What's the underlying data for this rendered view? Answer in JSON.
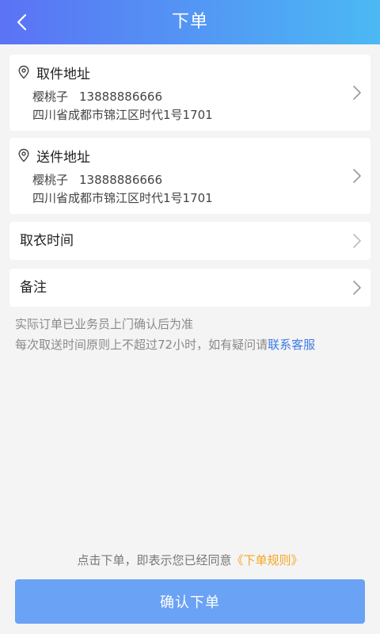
{
  "header": {
    "title": "下单"
  },
  "pickup": {
    "title": "取件地址",
    "name": "樱桃子",
    "phone": "13888886666",
    "address": "四川省成都市锦江区时代1号1701"
  },
  "delivery": {
    "title": "送件地址",
    "name": "樱桃子",
    "phone": "13888886666",
    "address": "四川省成都市锦江区时代1号1701"
  },
  "pickup_time": {
    "label": "取衣时间"
  },
  "remark": {
    "label": "备注"
  },
  "notes": {
    "line1": "实际订单已业务员上门确认后为准",
    "line2_prefix": "每次取送时间原则上不超过72小时，如有疑问请",
    "line2_link": "联系客服"
  },
  "agreement": {
    "prefix": "点击下单，即表示您已经同意",
    "link": "《下单规则》"
  },
  "confirm_button": {
    "label": "确认下单"
  },
  "colors": {
    "header_start": "#5b72f5",
    "header_end": "#4bb9f3",
    "link_blue": "#3d7be6",
    "link_orange": "#f5a623",
    "button": "#6aa2f5"
  }
}
